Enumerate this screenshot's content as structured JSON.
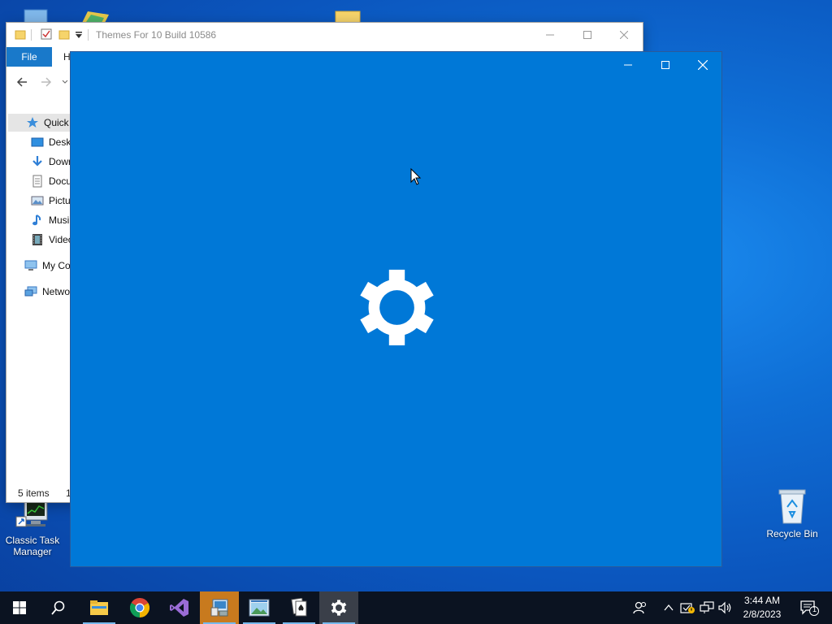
{
  "desktop": {
    "icons": [
      {
        "name": "Classic Task Manager",
        "lines": [
          "Classic Task",
          "Manager"
        ]
      },
      {
        "name": "Recycle Bin",
        "lines": [
          "Recycle Bin"
        ]
      }
    ]
  },
  "explorer": {
    "title": "Themes For 10 Build 10586",
    "file_tab": "File",
    "home_tab_fragment": "H",
    "nav": [
      {
        "label": "Quick",
        "icon": "star-icon"
      },
      {
        "label": "Desk",
        "icon": "desktop-folder-icon"
      },
      {
        "label": "Dowr",
        "icon": "download-icon"
      },
      {
        "label": "Docu",
        "icon": "document-icon"
      },
      {
        "label": "Pictu",
        "icon": "pictures-icon"
      },
      {
        "label": "Musi",
        "icon": "music-icon"
      },
      {
        "label": "Video",
        "icon": "video-icon"
      },
      {
        "label": "My Co",
        "icon": "computer-icon"
      },
      {
        "label": "Netwo",
        "icon": "network-icon"
      }
    ],
    "status_items": "5 items",
    "status_fragment": "1"
  },
  "settings_window": {
    "accent": "#0078d7",
    "icon": "gear-icon"
  },
  "taskbar": {
    "clock_time": "3:44 AM",
    "clock_date": "2/8/2023",
    "notification_count": "1",
    "pinned": [
      "start-icon",
      "search-icon",
      "file-explorer-icon",
      "chrome-icon",
      "visual-studio-icon",
      "control-panel-icon",
      "image-viewer-icon",
      "solitaire-icon",
      "settings-gear-icon"
    ]
  }
}
